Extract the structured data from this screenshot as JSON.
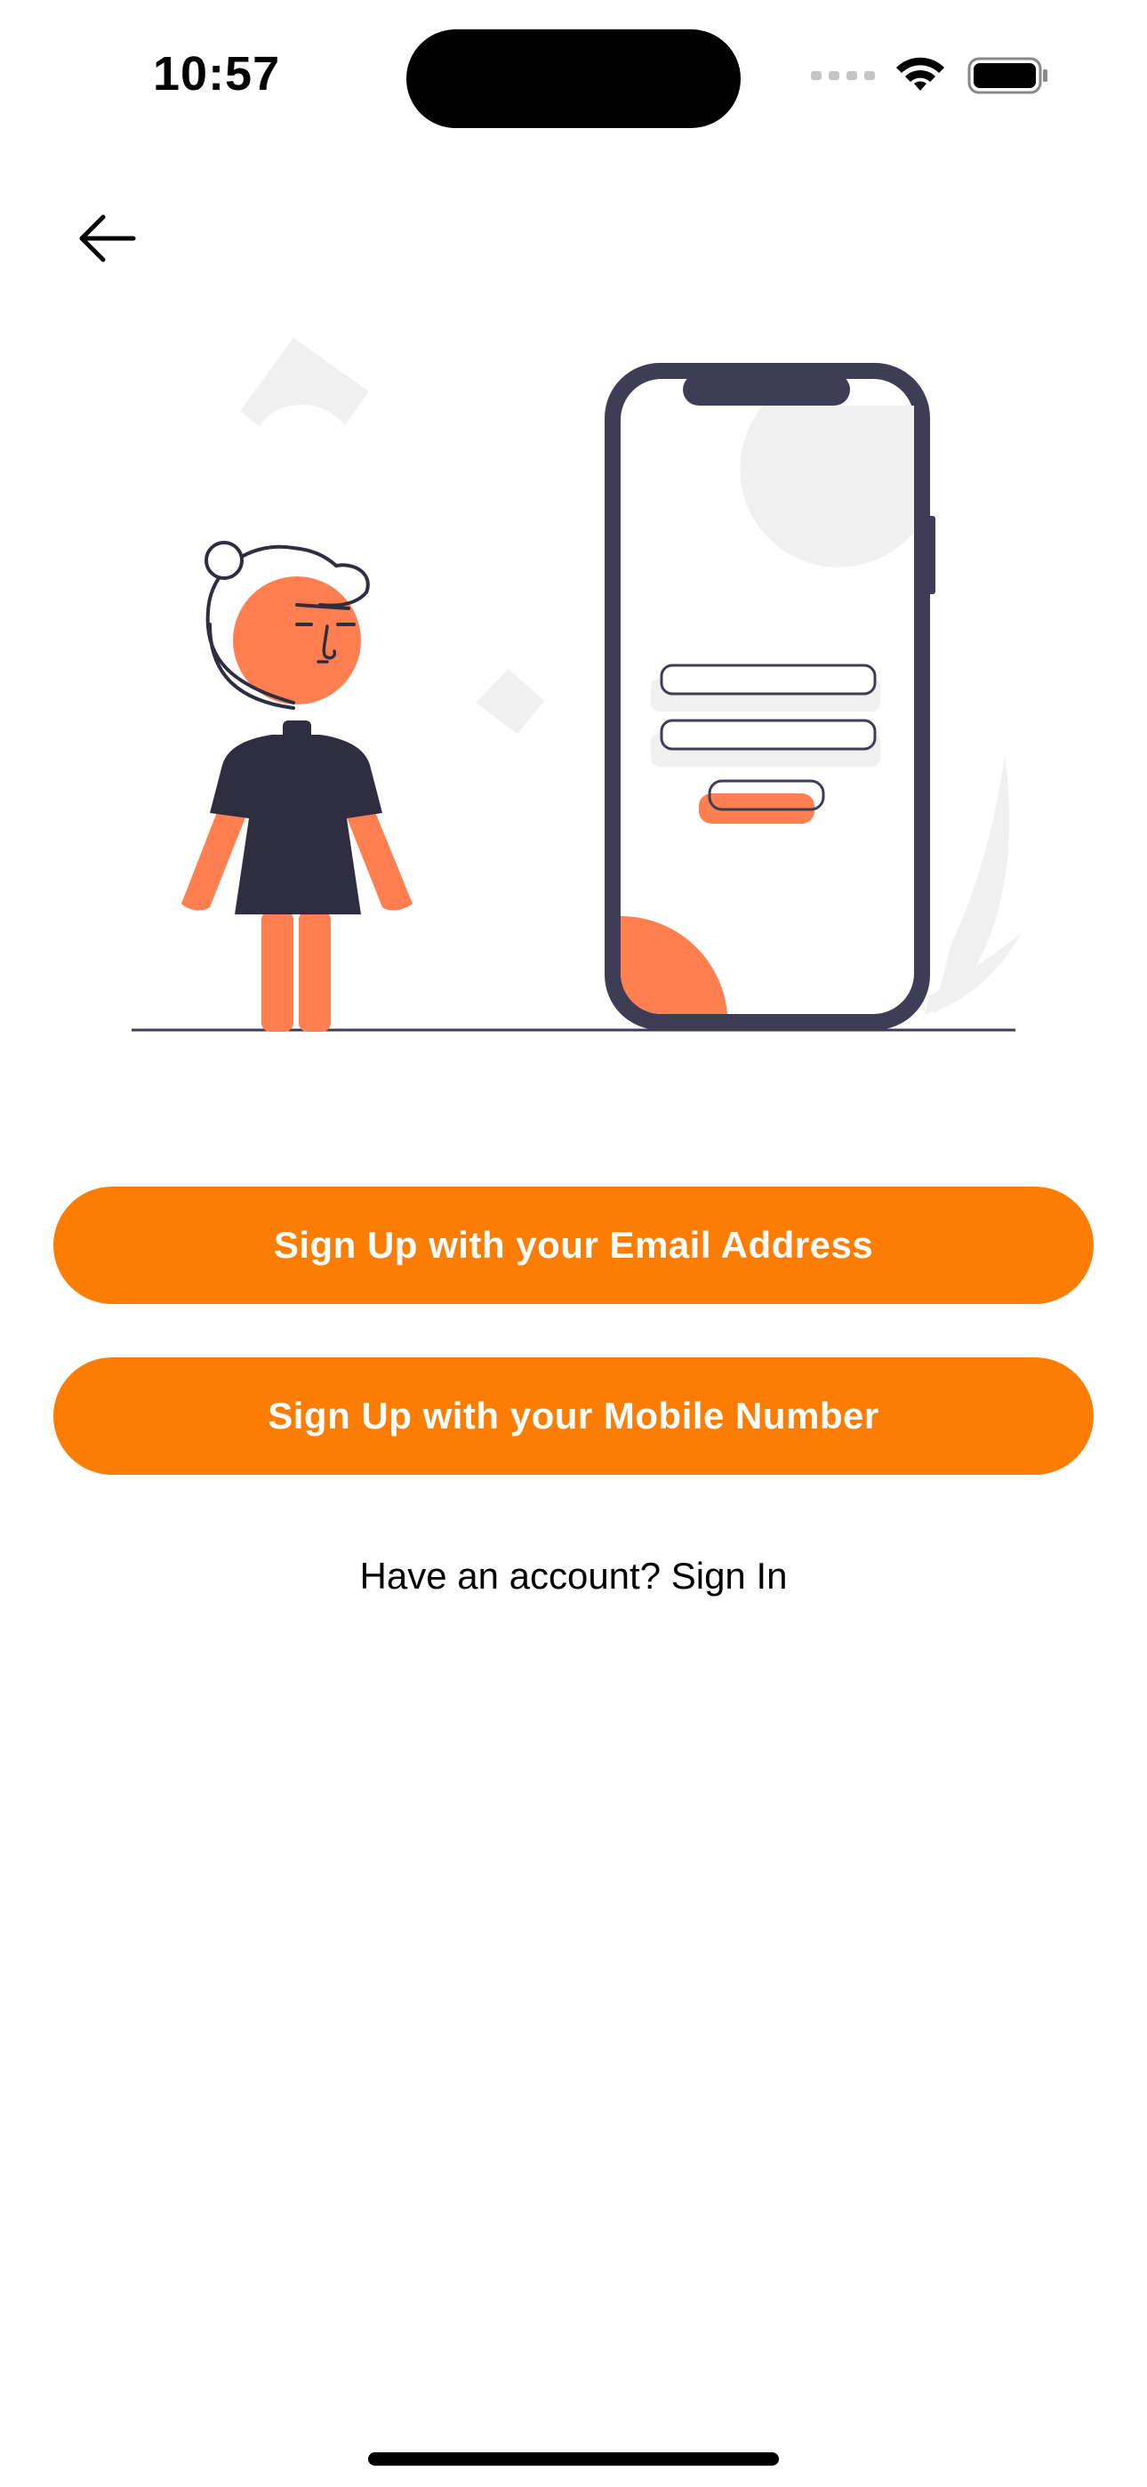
{
  "status_bar": {
    "time": "10:57"
  },
  "navigation": {
    "back_icon": "arrow-left-icon"
  },
  "illustration": {
    "icon": "person-with-phone-login-illustration",
    "colors": {
      "accent": "#ff7f50",
      "dark": "#3f3d56",
      "light": "#f0f0f0"
    }
  },
  "actions": {
    "email_signup_label": "Sign Up with your Email Address",
    "mobile_signup_label": "Sign Up with your Mobile Number",
    "signin_text": "Have an account? Sign In"
  },
  "theme": {
    "button_color": "#fd7d02",
    "button_text_color": "#ffffff"
  }
}
